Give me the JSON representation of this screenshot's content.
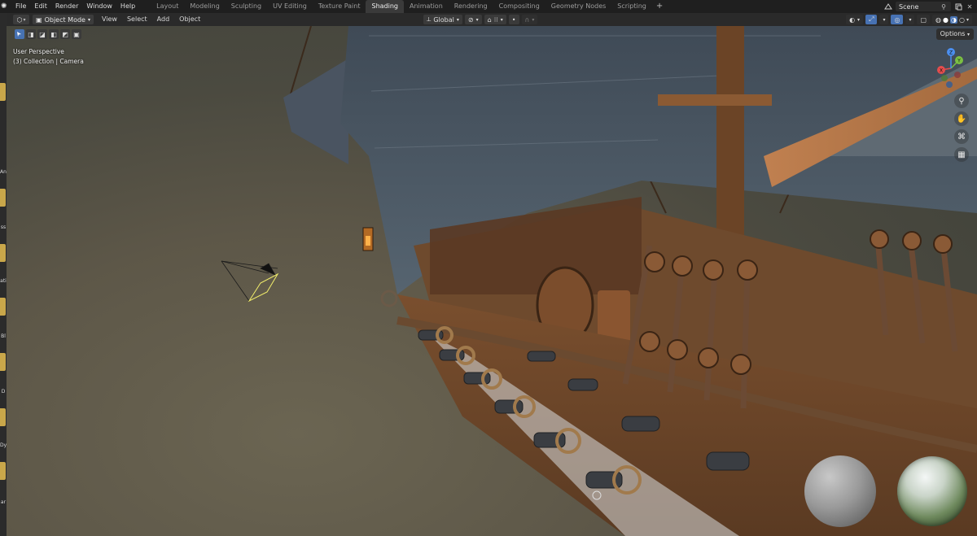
{
  "topbar": {
    "menus": [
      "File",
      "Edit",
      "Render",
      "Window",
      "Help"
    ],
    "workspaces": [
      "Layout",
      "Modeling",
      "Sculpting",
      "UV Editing",
      "Texture Paint",
      "Shading",
      "Animation",
      "Rendering",
      "Compositing",
      "Geometry Nodes",
      "Scripting"
    ],
    "active_workspace": "Shading",
    "add_workspace": "+",
    "scene_name": "Scene"
  },
  "viewport_header": {
    "mode": "Object Mode",
    "menus": [
      "View",
      "Select",
      "Add",
      "Object"
    ],
    "transform_orientation": "Global",
    "options_label": "Options"
  },
  "viewport": {
    "perspective": "User Perspective",
    "collection": "(3) Collection | Camera"
  },
  "gizmo": {
    "x": "X",
    "y": "Y",
    "z": "Z"
  },
  "left_strip_labels": [
    "An",
    "ss",
    "ati",
    "Bl",
    "D",
    "Dy",
    "ar"
  ],
  "colors": {
    "accent": "#4772b3",
    "gizmo_x": "#e44d4d",
    "gizmo_y": "#7bc043",
    "gizmo_z": "#4b8ff0",
    "camera_active": "#f3ef6b",
    "strip_tab": "#c9a74a"
  },
  "icons": [
    "blender-logo-icon",
    "editor-type-icon",
    "mode-icon",
    "orientation-icon",
    "pivot-icon",
    "snap-icon",
    "proportional-icon",
    "visibility-icon",
    "gizmo-toggle-icon",
    "overlay-icon",
    "xray-icon",
    "shading-wireframe-icon",
    "shading-solid-icon",
    "shading-material-icon",
    "shading-rendered-icon",
    "zoom-icon",
    "pan-hand-icon",
    "camera-view-icon",
    "grid-view-icon",
    "scene-icon",
    "pin-icon",
    "new-scene-icon"
  ]
}
